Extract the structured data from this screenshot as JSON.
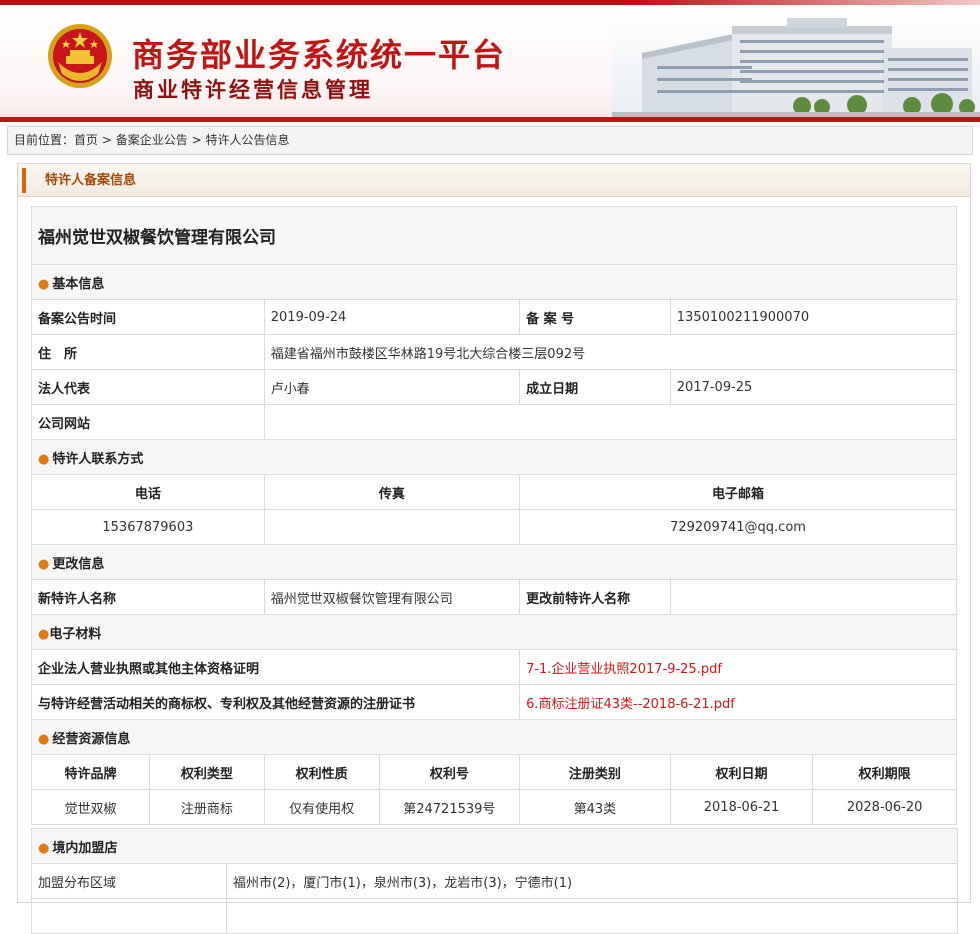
{
  "header": {
    "title": "商务部业务系统统一平台",
    "subtitle": "商业特许经营信息管理"
  },
  "breadcrumb": {
    "label": "目前位置：",
    "items": [
      "首页",
      "备案企业公告",
      "特许人公告信息"
    ],
    "separator": ">"
  },
  "panel": {
    "title": "特许人备案信息"
  },
  "company": {
    "name": "福州觉世双椒餐饮管理有限公司"
  },
  "basic": {
    "section": "基本信息",
    "filing_date_label": "备案公告时间",
    "filing_date": "2019-09-24",
    "filing_no_label": "备 案 号",
    "filing_no": "1350100211900070",
    "address_label": "住　所",
    "address": "福建省福州市鼓楼区华林路19号北大综合楼三层092号",
    "legal_rep_label": "法人代表",
    "legal_rep": "卢小春",
    "established_label": "成立日期",
    "established": "2017-09-25",
    "website_label": "公司网站",
    "website": ""
  },
  "contact": {
    "section": "特许人联系方式",
    "phone_label": "电话",
    "fax_label": "传真",
    "email_label": "电子邮箱",
    "phone": "15367879603",
    "fax": "",
    "email": "729209741@qq.com"
  },
  "changes": {
    "section": "更改信息",
    "new_name_label": "新特许人名称",
    "new_name": "福州觉世双椒餐饮管理有限公司",
    "old_name_label": "更改前特许人名称",
    "old_name": ""
  },
  "materials": {
    "section": "电子材料",
    "items": [
      {
        "label": "企业法人营业执照或其他主体资格证明",
        "file": "7-1.企业营业执照2017-9-25.pdf"
      },
      {
        "label": "与特许经营活动相关的商标权、专利权及其他经营资源的注册证书",
        "file": "6.商标注册证43类--2018-6-21.pdf"
      }
    ]
  },
  "resources": {
    "section": "经营资源信息",
    "columns": [
      "特许品牌",
      "权利类型",
      "权利性质",
      "权利号",
      "注册类别",
      "权利日期",
      "权利期限"
    ],
    "rows": [
      [
        "觉世双椒",
        "注册商标",
        "仅有使用权",
        "第24721539号",
        "第43类",
        "2018-06-21",
        "2028-06-20"
      ]
    ]
  },
  "stores": {
    "section": "境内加盟店",
    "region_label": "加盟分布区域",
    "regions": "福州市(2)，厦门市(1)，泉州市(3)，龙岩市(3)，宁德市(1)"
  },
  "colors": {
    "brand_red": "#c01515",
    "accent_orange": "#e07a10",
    "link_red": "#d21616"
  }
}
